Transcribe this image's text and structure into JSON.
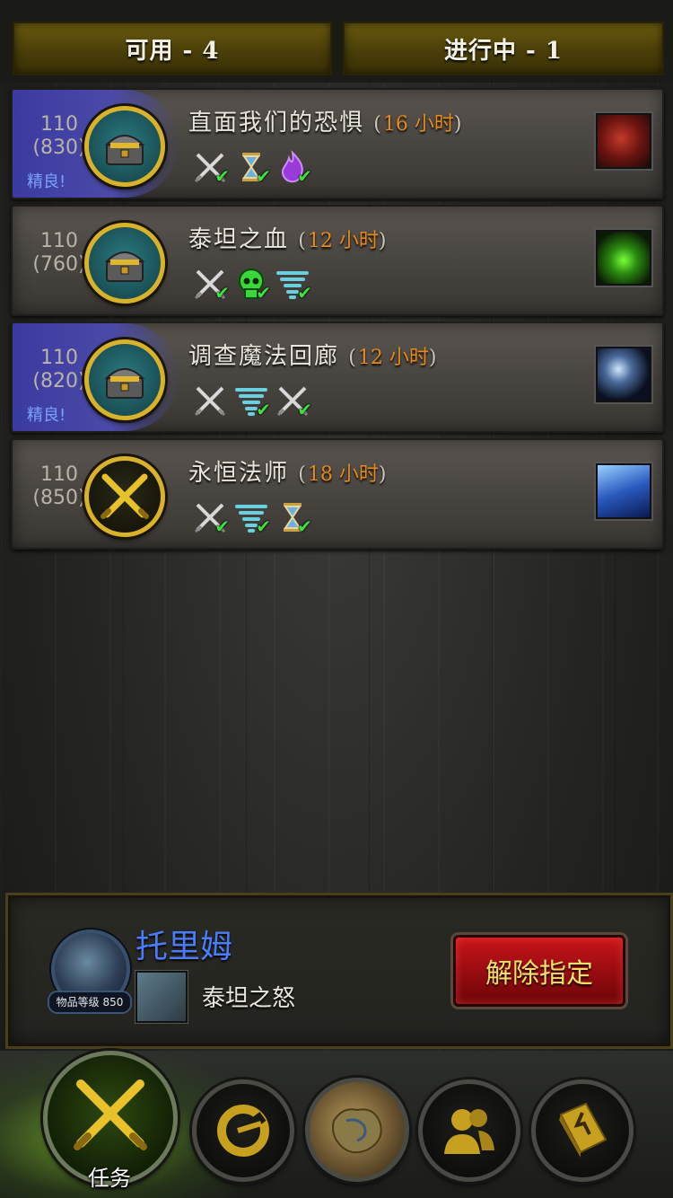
{
  "tabs": {
    "available": "可用 - 4",
    "in_progress": "进行中 - 1"
  },
  "missions": [
    {
      "level": "110",
      "item_level": "(830)",
      "elite": "精良!",
      "title": "直面我们的恐惧",
      "duration": "16 小时",
      "reward": "treasure-chest",
      "abilities": [
        "crossed-swords-icon",
        "hourglass-icon",
        "purple-flame-icon"
      ],
      "enemy": "red-creature-portrait"
    },
    {
      "level": "110",
      "item_level": "(760)",
      "elite": "",
      "title": "泰坦之血",
      "duration": "12 小时",
      "reward": "treasure-chest",
      "abilities": [
        "crossed-swords-icon",
        "green-skull-icon",
        "cyclone-icon"
      ],
      "enemy": "green-fel-portrait"
    },
    {
      "level": "110",
      "item_level": "(820)",
      "elite": "精良!",
      "title": "调查魔法回廊",
      "duration": "12 小时",
      "reward": "treasure-chest",
      "abilities": [
        "crossed-swords-icon",
        "cyclone-icon",
        "crossed-swords-icon"
      ],
      "enemy": "orb-portrait"
    },
    {
      "level": "110",
      "item_level": "(850)",
      "elite": "",
      "title": "永恒法师",
      "duration": "18 小时",
      "reward": "crossed-swords",
      "abilities": [
        "crossed-swords-icon",
        "cyclone-icon",
        "hourglass-icon"
      ],
      "enemy": "blue-mage-portrait"
    }
  ],
  "champion": {
    "name": "托里姆",
    "item_level": "物品等级 850",
    "spec": "泰坦之怒",
    "unassign_label": "解除指定"
  },
  "nav": {
    "missions_label": "任务"
  },
  "colors": {
    "duration": "#e88a1a",
    "elite": "#7aa2ff",
    "champion_name": "#4a7cff",
    "check": "#3fe03f"
  }
}
